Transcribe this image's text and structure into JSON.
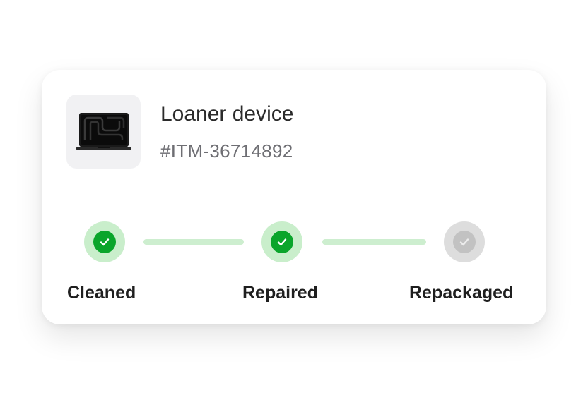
{
  "device": {
    "title": "Loaner device",
    "item_id": "#ITM-36714892",
    "image_icon": "laptop-icon"
  },
  "steps": [
    {
      "label": "Cleaned",
      "status": "complete"
    },
    {
      "label": "Repaired",
      "status": "complete"
    },
    {
      "label": "Repackaged",
      "status": "pending"
    }
  ],
  "colors": {
    "complete_fill": "#0aa52b",
    "complete_ring": "#c9eecb",
    "pending_fill": "#c2c2c2",
    "pending_ring": "#dddddd",
    "connector": "#cdeecf"
  }
}
